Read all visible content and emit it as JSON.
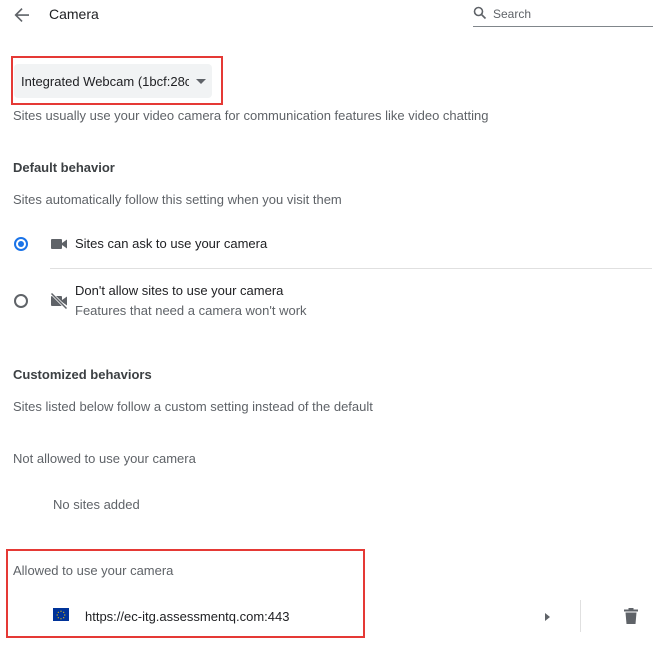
{
  "header": {
    "title": "Camera",
    "search_placeholder": "Search"
  },
  "camera_select": {
    "selected": "Integrated Webcam (1bcf:28c"
  },
  "intro": "Sites usually use your video camera for communication features like video chatting",
  "default_behavior": {
    "heading": "Default behavior",
    "description": "Sites automatically follow this setting when you visit them",
    "options": [
      {
        "label": "Sites can ask to use your camera",
        "sublabel": "",
        "selected": true,
        "icon": "videocam-icon"
      },
      {
        "label": "Don't allow sites to use your camera",
        "sublabel": "Features that need a camera won't work",
        "selected": false,
        "icon": "videocam-off-icon"
      }
    ]
  },
  "customized": {
    "heading": "Customized behaviors",
    "description": "Sites listed below follow a custom setting instead of the default",
    "not_allowed": {
      "title": "Not allowed to use your camera",
      "empty_text": "No sites added"
    },
    "allowed": {
      "title": "Allowed to use your camera",
      "sites": [
        {
          "url": "https://ec-itg.assessmentq.com:443",
          "icon": "eu-flag-icon"
        }
      ]
    }
  },
  "colors": {
    "accent": "#1a73e8",
    "highlight": "#e53935"
  }
}
